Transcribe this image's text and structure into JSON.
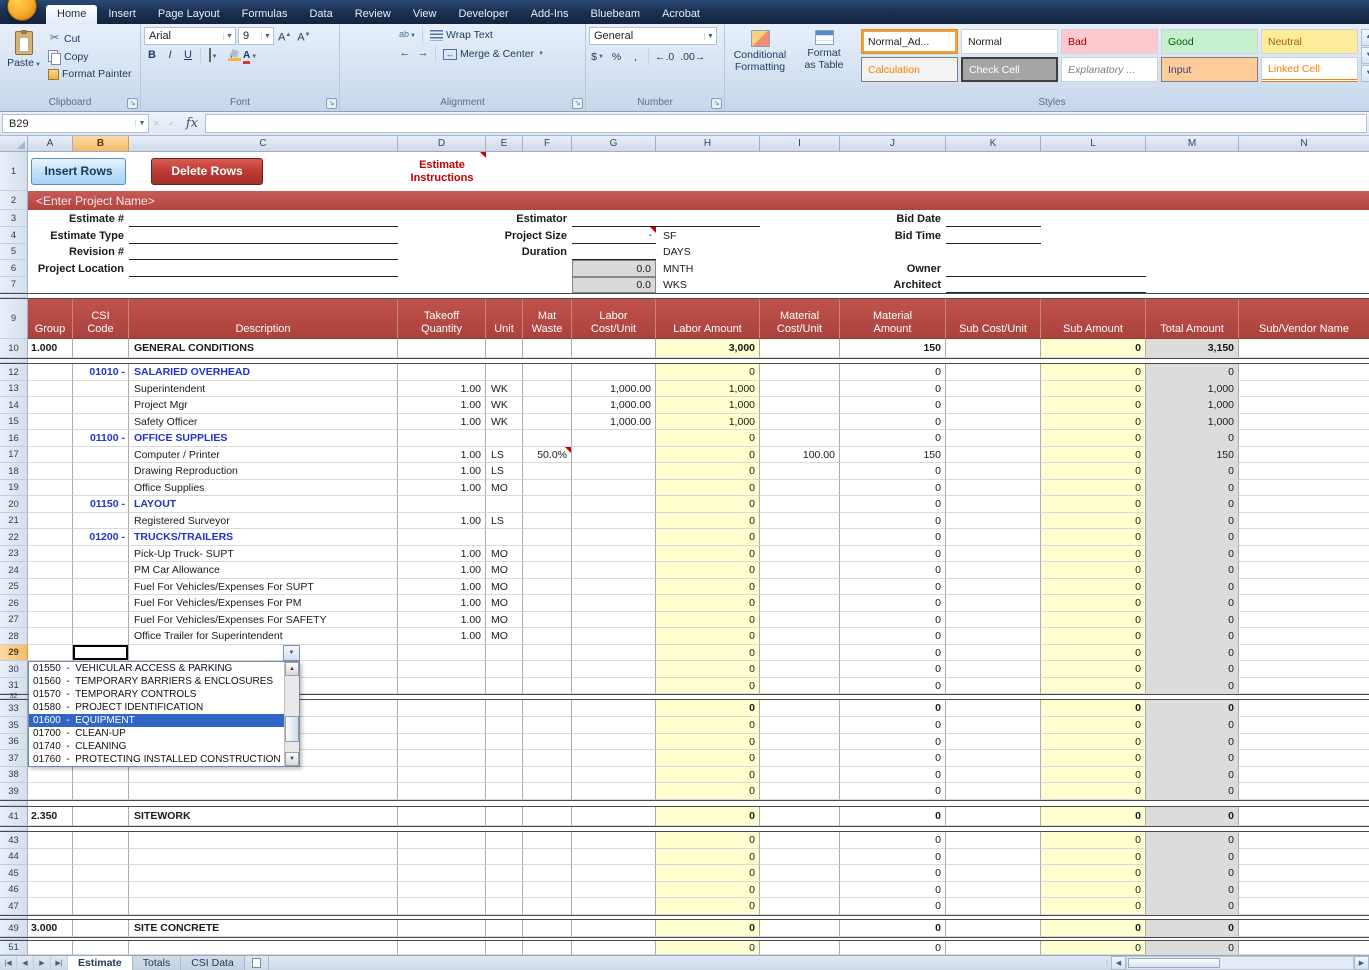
{
  "ribbon": {
    "tabs": [
      "Home",
      "Insert",
      "Page Layout",
      "Formulas",
      "Data",
      "Review",
      "View",
      "Developer",
      "Add-Ins",
      "Bluebeam",
      "Acrobat"
    ],
    "active_tab": "Home",
    "groups": {
      "clipboard": {
        "label": "Clipboard",
        "paste": "Paste",
        "cut": "Cut",
        "copy": "Copy",
        "format_painter": "Format Painter"
      },
      "font": {
        "label": "Font",
        "name": "Arial",
        "size": "9",
        "bold": "B",
        "italic": "I",
        "underline": "U"
      },
      "alignment": {
        "label": "Alignment",
        "wrap_text": "Wrap Text",
        "merge_center": "Merge & Center"
      },
      "number": {
        "label": "Number",
        "format": "General",
        "currency": "$",
        "percent": "%",
        "comma": ","
      },
      "styles": {
        "label": "Styles",
        "conditional_formatting": "Conditional\nFormatting",
        "format_as_table": "Format\nas Table",
        "cell_styles": [
          {
            "label": "Normal_Ad...",
            "kind": "normal",
            "selected": true
          },
          {
            "label": "Normal",
            "kind": "normal"
          },
          {
            "label": "Bad",
            "kind": "bad"
          },
          {
            "label": "Good",
            "kind": "good"
          },
          {
            "label": "Neutral",
            "kind": "neutral"
          },
          {
            "label": "Calculation",
            "kind": "calculation"
          },
          {
            "label": "Check Cell",
            "kind": "check"
          },
          {
            "label": "Explanatory ...",
            "kind": "explanatory"
          },
          {
            "label": "Input",
            "kind": "input"
          },
          {
            "label": "Linked Cell",
            "kind": "linked"
          }
        ]
      }
    }
  },
  "formula_bar": {
    "name_box": "B29",
    "fx": "fx",
    "content": ""
  },
  "sheet": {
    "selected_cell": "B29",
    "selected_column": "B",
    "selected_row": "29",
    "columns": [
      "A",
      "B",
      "C",
      "D",
      "E",
      "F",
      "G",
      "H",
      "I",
      "J",
      "K",
      "L",
      "M",
      "N"
    ],
    "rows": [
      {
        "n": "1",
        "h": 39,
        "k": "form",
        "cells": [
          {
            "c": "A",
            "s": 2,
            "t": "Insert Rows",
            "k": "insert-btn"
          },
          {
            "c": "C",
            "t": "Delete Rows",
            "k": "delete-btn"
          },
          {
            "c": "D",
            "t": "Estimate\nInstructions",
            "k": "instr marker"
          }
        ]
      },
      {
        "n": "2",
        "h": 19,
        "k": "banner",
        "cells": [
          {
            "c": "A",
            "s": 14,
            "t": "<Enter Project Name>",
            "k": "banner-text"
          }
        ]
      },
      {
        "n": "3",
        "h": 17,
        "k": "form",
        "cells": [
          {
            "c": "A",
            "s": 2,
            "t": "Estimate #",
            "k": "lbl"
          },
          {
            "c": "C",
            "k": "field"
          },
          {
            "c": "E",
            "s": 2,
            "t": "Estimator",
            "k": "lbl"
          },
          {
            "c": "G",
            "s": 2,
            "k": "field"
          },
          {
            "c": "I",
            "s": 2,
            "t": "Bid Date",
            "k": "lbl"
          },
          {
            "c": "K",
            "k": "field"
          }
        ]
      },
      {
        "n": "4",
        "h": 17,
        "k": "form",
        "cells": [
          {
            "c": "A",
            "s": 2,
            "t": "Estimate Type",
            "k": "lbl"
          },
          {
            "c": "C",
            "k": "field"
          },
          {
            "c": "E",
            "s": 2,
            "t": "Project Size",
            "k": "lbl"
          },
          {
            "c": "G",
            "t": "-",
            "k": "num field marker"
          },
          {
            "c": "H",
            "t": "SF",
            "k": "unit"
          },
          {
            "c": "I",
            "s": 2,
            "t": "Bid Time",
            "k": "lbl"
          },
          {
            "c": "K",
            "k": "field"
          }
        ]
      },
      {
        "n": "5",
        "h": 16,
        "k": "form",
        "cells": [
          {
            "c": "A",
            "s": 2,
            "t": "Revision #",
            "k": "lbl"
          },
          {
            "c": "C",
            "k": "field"
          },
          {
            "c": "E",
            "s": 2,
            "t": "Duration",
            "k": "lbl"
          },
          {
            "c": "G",
            "k": "field"
          },
          {
            "c": "H",
            "t": "DAYS",
            "k": "unit"
          }
        ]
      },
      {
        "n": "6",
        "h": 17,
        "k": "form",
        "cells": [
          {
            "c": "A",
            "s": 2,
            "t": "Project Location",
            "k": "lbl"
          },
          {
            "c": "C",
            "k": "field"
          },
          {
            "c": "G",
            "t": "0.0",
            "k": "graybox"
          },
          {
            "c": "H",
            "t": "MNTH",
            "k": "unit"
          },
          {
            "c": "I",
            "s": 2,
            "t": "Owner",
            "k": "lbl"
          },
          {
            "c": "K",
            "s": 2,
            "k": "field"
          }
        ]
      },
      {
        "n": "7",
        "h": 16,
        "k": "form",
        "cells": [
          {
            "c": "G",
            "t": "0.0",
            "k": "graybox"
          },
          {
            "c": "H",
            "t": "WKS",
            "k": "unit"
          },
          {
            "c": "I",
            "s": 2,
            "t": "Architect",
            "k": "lbl"
          },
          {
            "c": "K",
            "s": 2,
            "k": "field"
          }
        ]
      },
      {
        "n": "",
        "h": 6,
        "k": "sliver"
      },
      {
        "n": "9",
        "h": 40,
        "k": "header",
        "cells": [
          {
            "c": "A",
            "t": "Group"
          },
          {
            "c": "B",
            "t": "CSI\nCode"
          },
          {
            "c": "C",
            "t": "Description"
          },
          {
            "c": "D",
            "t": "Takeoff\nQuantity"
          },
          {
            "c": "E",
            "t": "Unit"
          },
          {
            "c": "F",
            "t": "Mat\nWaste"
          },
          {
            "c": "G",
            "t": "Labor\nCost/Unit"
          },
          {
            "c": "H",
            "t": "Labor Amount"
          },
          {
            "c": "I",
            "t": "Material\nCost/Unit"
          },
          {
            "c": "J",
            "t": "Material\nAmount"
          },
          {
            "c": "K",
            "t": "Sub Cost/Unit"
          },
          {
            "c": "L",
            "t": "Sub Amount"
          },
          {
            "c": "M",
            "t": "Total Amount"
          },
          {
            "c": "N",
            "t": "Sub/Vendor Name"
          }
        ]
      },
      {
        "n": "10",
        "h": 19,
        "k": "table section",
        "z": true,
        "cells": [
          {
            "c": "A",
            "t": "1.000",
            "k": "grp"
          },
          {
            "c": "C",
            "t": "GENERAL CONDITIONS",
            "k": "txt"
          },
          {
            "c": "H",
            "t": "3,000",
            "k": "num"
          },
          {
            "c": "J",
            "t": "150",
            "k": "num"
          },
          {
            "c": "M",
            "t": "3,150",
            "k": "num"
          }
        ]
      },
      {
        "n": "",
        "h": 6,
        "k": "sliver"
      },
      {
        "n": "12",
        "h": 17,
        "k": "table",
        "z": true,
        "cells": [
          {
            "c": "B",
            "t": "01010 -",
            "k": "csi"
          },
          {
            "c": "C",
            "t": "SALARIED OVERHEAD",
            "k": "csiname"
          }
        ]
      },
      {
        "n": "13",
        "h": 16,
        "k": "table",
        "z": true,
        "cells": [
          {
            "c": "C",
            "t": "Superintendent",
            "k": "txt"
          },
          {
            "c": "D",
            "t": "1.00",
            "k": "num"
          },
          {
            "c": "E",
            "t": "WK",
            "k": "txt"
          },
          {
            "c": "G",
            "t": "1,000.00",
            "k": "num"
          },
          {
            "c": "H",
            "t": "1,000",
            "k": "num"
          },
          {
            "c": "M",
            "t": "1,000",
            "k": "num"
          }
        ]
      },
      {
        "n": "14",
        "h": 17,
        "k": "table",
        "z": true,
        "cells": [
          {
            "c": "C",
            "t": "Project Mgr",
            "k": "txt"
          },
          {
            "c": "D",
            "t": "1.00",
            "k": "num"
          },
          {
            "c": "E",
            "t": "WK",
            "k": "txt"
          },
          {
            "c": "G",
            "t": "1,000.00",
            "k": "num"
          },
          {
            "c": "H",
            "t": "1,000",
            "k": "num"
          },
          {
            "c": "M",
            "t": "1,000",
            "k": "num"
          }
        ]
      },
      {
        "n": "15",
        "h": 16,
        "k": "table",
        "z": true,
        "cells": [
          {
            "c": "C",
            "t": "Safety Officer",
            "k": "txt"
          },
          {
            "c": "D",
            "t": "1.00",
            "k": "num"
          },
          {
            "c": "E",
            "t": "WK",
            "k": "txt"
          },
          {
            "c": "G",
            "t": "1,000.00",
            "k": "num"
          },
          {
            "c": "H",
            "t": "1,000",
            "k": "num"
          },
          {
            "c": "M",
            "t": "1,000",
            "k": "num"
          }
        ]
      },
      {
        "n": "16",
        "h": 17,
        "k": "table",
        "z": true,
        "cells": [
          {
            "c": "B",
            "t": "01100 -",
            "k": "csi"
          },
          {
            "c": "C",
            "t": "OFFICE SUPPLIES",
            "k": "csiname"
          }
        ]
      },
      {
        "n": "17",
        "h": 16,
        "k": "table",
        "z": true,
        "cells": [
          {
            "c": "C",
            "t": "Computer / Printer",
            "k": "txt"
          },
          {
            "c": "D",
            "t": "1.00",
            "k": "num"
          },
          {
            "c": "E",
            "t": "LS",
            "k": "txt"
          },
          {
            "c": "F",
            "t": "50.0%",
            "k": "num marker"
          },
          {
            "c": "I",
            "t": "100.00",
            "k": "num"
          },
          {
            "c": "J",
            "t": "150",
            "k": "num"
          },
          {
            "c": "M",
            "t": "150",
            "k": "num"
          }
        ]
      },
      {
        "n": "18",
        "h": 17,
        "k": "table",
        "z": true,
        "cells": [
          {
            "c": "C",
            "t": "Drawing Reproduction",
            "k": "txt"
          },
          {
            "c": "D",
            "t": "1.00",
            "k": "num"
          },
          {
            "c": "E",
            "t": "LS",
            "k": "txt"
          }
        ]
      },
      {
        "n": "19",
        "h": 16,
        "k": "table",
        "z": true,
        "cells": [
          {
            "c": "C",
            "t": "Office Supplies",
            "k": "txt"
          },
          {
            "c": "D",
            "t": "1.00",
            "k": "num"
          },
          {
            "c": "E",
            "t": "MO",
            "k": "txt"
          }
        ]
      },
      {
        "n": "20",
        "h": 17,
        "k": "table",
        "z": true,
        "cells": [
          {
            "c": "B",
            "t": "01150 -",
            "k": "csi"
          },
          {
            "c": "C",
            "t": "LAYOUT",
            "k": "csiname"
          }
        ]
      },
      {
        "n": "21",
        "h": 16,
        "k": "table",
        "z": true,
        "cells": [
          {
            "c": "C",
            "t": "Registered Surveyor",
            "k": "txt"
          },
          {
            "c": "D",
            "t": "1.00",
            "k": "num"
          },
          {
            "c": "E",
            "t": "LS",
            "k": "txt"
          }
        ]
      },
      {
        "n": "22",
        "h": 17,
        "k": "table",
        "z": true,
        "cells": [
          {
            "c": "B",
            "t": "01200 -",
            "k": "csi"
          },
          {
            "c": "C",
            "t": "TRUCKS/TRAILERS",
            "k": "csiname"
          }
        ]
      },
      {
        "n": "23",
        "h": 16,
        "k": "table",
        "z": true,
        "cells": [
          {
            "c": "C",
            "t": "Pick-Up Truck- SUPT",
            "k": "txt"
          },
          {
            "c": "D",
            "t": "1.00",
            "k": "num"
          },
          {
            "c": "E",
            "t": "MO",
            "k": "txt"
          }
        ]
      },
      {
        "n": "24",
        "h": 17,
        "k": "table",
        "z": true,
        "cells": [
          {
            "c": "C",
            "t": "PM Car Allowance",
            "k": "txt"
          },
          {
            "c": "D",
            "t": "1.00",
            "k": "num"
          },
          {
            "c": "E",
            "t": "MO",
            "k": "txt"
          }
        ]
      },
      {
        "n": "25",
        "h": 16,
        "k": "table",
        "z": true,
        "cells": [
          {
            "c": "C",
            "t": "Fuel For Vehicles/Expenses For SUPT",
            "k": "txt"
          },
          {
            "c": "D",
            "t": "1.00",
            "k": "num"
          },
          {
            "c": "E",
            "t": "MO",
            "k": "txt"
          }
        ]
      },
      {
        "n": "26",
        "h": 17,
        "k": "table",
        "z": true,
        "cells": [
          {
            "c": "C",
            "t": "Fuel For Vehicles/Expenses For PM",
            "k": "txt"
          },
          {
            "c": "D",
            "t": "1.00",
            "k": "num"
          },
          {
            "c": "E",
            "t": "MO",
            "k": "txt"
          }
        ]
      },
      {
        "n": "27",
        "h": 16,
        "k": "table",
        "z": true,
        "cells": [
          {
            "c": "C",
            "t": "Fuel For Vehicles/Expenses For SAFETY",
            "k": "txt"
          },
          {
            "c": "D",
            "t": "1.00",
            "k": "num"
          },
          {
            "c": "E",
            "t": "MO",
            "k": "txt"
          }
        ]
      },
      {
        "n": "28",
        "h": 17,
        "k": "table",
        "z": true,
        "cells": [
          {
            "c": "C",
            "t": "Office Trailer for Superintendent",
            "k": "txt"
          },
          {
            "c": "D",
            "t": "1.00",
            "k": "num"
          },
          {
            "c": "E",
            "t": "MO",
            "k": "txt"
          }
        ]
      },
      {
        "n": "29",
        "h": 16,
        "k": "table",
        "z": true,
        "sel": true,
        "cells": [
          {
            "c": "B",
            "k": "selcell"
          }
        ]
      },
      {
        "n": "30",
        "h": 17,
        "k": "table",
        "z": true
      },
      {
        "n": "31",
        "h": 16,
        "k": "table",
        "z": true
      },
      {
        "n": "32",
        "h": 6,
        "k": "sliver"
      },
      {
        "n": "33",
        "h": 17,
        "k": "table section",
        "z": true
      },
      {
        "n": "35",
        "h": 17,
        "k": "table",
        "z": true
      },
      {
        "n": "36",
        "h": 16,
        "k": "table",
        "z": true
      },
      {
        "n": "37",
        "h": 17,
        "k": "table",
        "z": true
      },
      {
        "n": "38",
        "h": 16,
        "k": "table",
        "z": true
      },
      {
        "n": "39",
        "h": 17,
        "k": "table",
        "z": true
      },
      {
        "n": "",
        "h": 7,
        "k": "sliver"
      },
      {
        "n": "41",
        "h": 19,
        "k": "table section",
        "z": true,
        "cells": [
          {
            "c": "A",
            "t": "2.350",
            "k": "grp"
          },
          {
            "c": "C",
            "t": "SITEWORK",
            "k": "txt"
          }
        ]
      },
      {
        "n": "",
        "h": 6,
        "k": "sliver"
      },
      {
        "n": "43",
        "h": 17,
        "k": "table",
        "z": true
      },
      {
        "n": "44",
        "h": 16,
        "k": "table",
        "z": true
      },
      {
        "n": "45",
        "h": 17,
        "k": "table",
        "z": true
      },
      {
        "n": "46",
        "h": 16,
        "k": "table",
        "z": true
      },
      {
        "n": "47",
        "h": 17,
        "k": "table",
        "z": true
      },
      {
        "n": "",
        "h": 5,
        "k": "sliver"
      },
      {
        "n": "49",
        "h": 17,
        "k": "table section",
        "z": true,
        "cells": [
          {
            "c": "A",
            "t": "3.000",
            "k": "grp"
          },
          {
            "c": "C",
            "t": "SITE CONCRETE",
            "k": "txt"
          }
        ]
      },
      {
        "n": "",
        "h": 4,
        "k": "sliver"
      },
      {
        "n": "51",
        "h": 14,
        "k": "table",
        "z": true
      }
    ],
    "dropdown": {
      "items": [
        "01550  -  VEHICULAR ACCESS & PARKING",
        "01560  -  TEMPORARY BARRIERS & ENCLOSURES",
        "01570  -  TEMPORARY CONTROLS",
        "01580  -  PROJECT IDENTIFICATION",
        "01600  -  EQUIPMENT",
        "01700  -  CLEAN-UP",
        "01740  -  CLEANING",
        "01760  -  PROTECTING INSTALLED CONSTRUCTION"
      ],
      "selected_index": 4
    }
  },
  "sheet_tabs": {
    "tabs": [
      "Estimate",
      "Totals",
      "CSI Data"
    ],
    "active": "Estimate"
  }
}
